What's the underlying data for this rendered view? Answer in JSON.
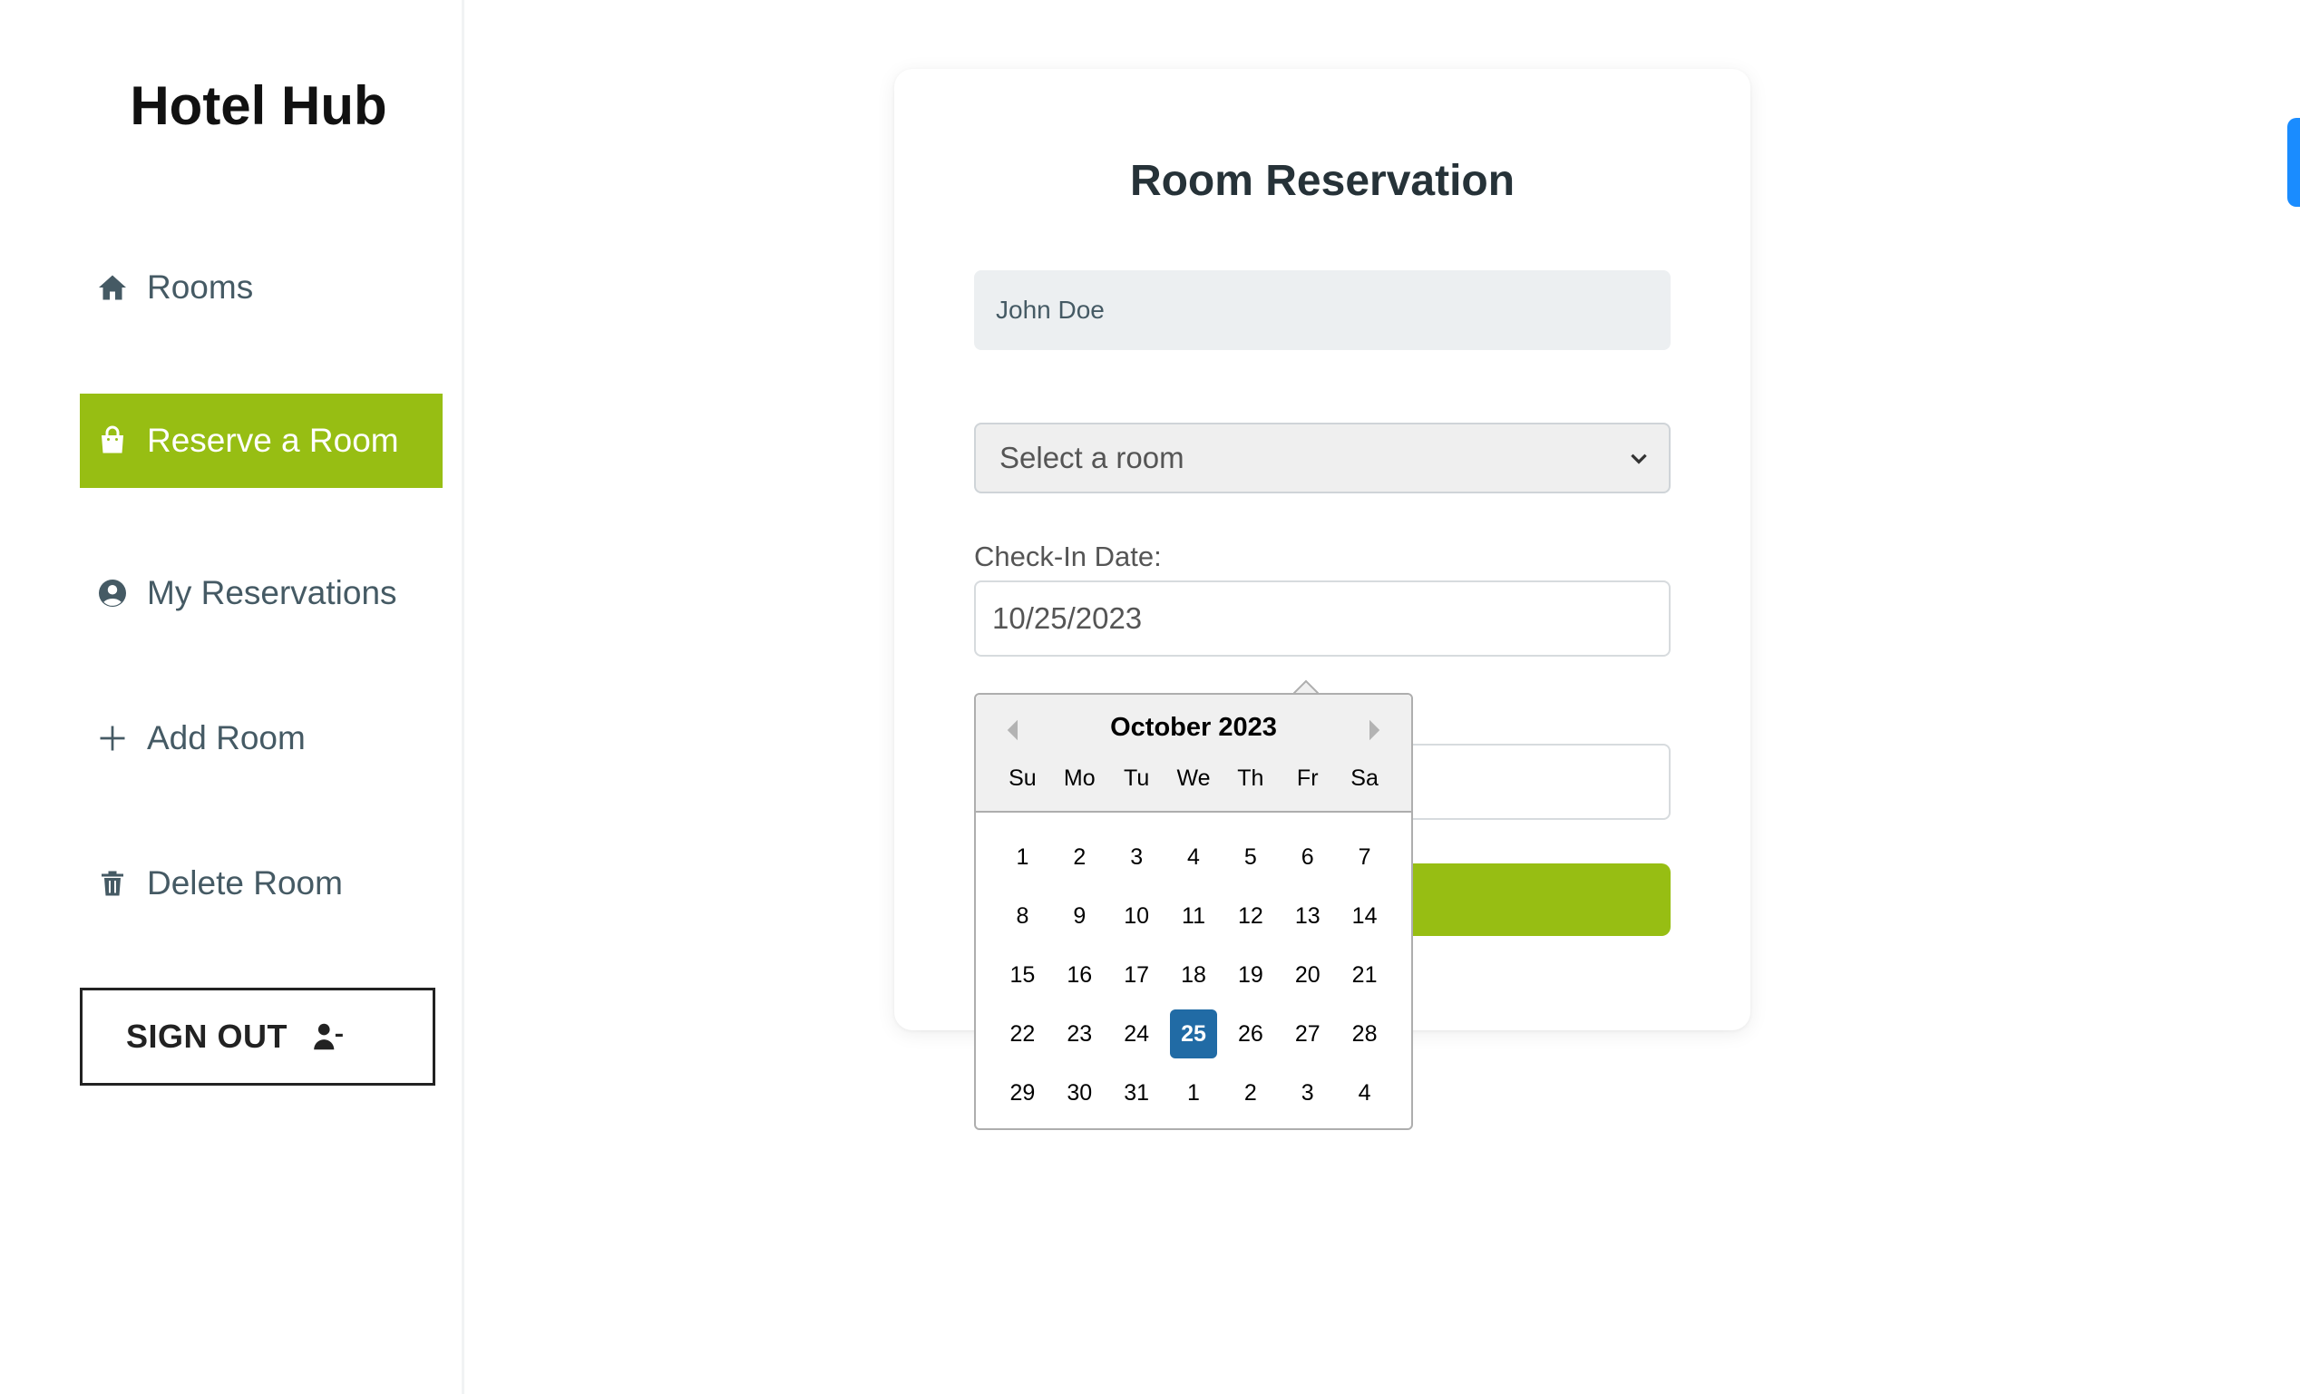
{
  "sidebar": {
    "brand": "Hotel Hub",
    "items": [
      {
        "label": "Rooms",
        "icon": "home-icon"
      },
      {
        "label": "Reserve a Room",
        "icon": "shopping-bag-icon",
        "active": true
      },
      {
        "label": "My Reservations",
        "icon": "user-circle-icon"
      },
      {
        "label": "Add Room",
        "icon": "plus-icon"
      },
      {
        "label": "Delete Room",
        "icon": "trash-icon"
      }
    ],
    "signout": {
      "label": "SIGN OUT",
      "icon": "user-minus-icon"
    }
  },
  "form": {
    "title": "Room Reservation",
    "name_value": "John Doe",
    "room_select": {
      "selected": "Select a room"
    },
    "checkin_label": "Check-In Date:",
    "checkin_value": "10/25/2023",
    "checkout_value": "",
    "submit_label": ""
  },
  "datepicker": {
    "month_label": "October 2023",
    "weekdays": [
      "Su",
      "Mo",
      "Tu",
      "We",
      "Th",
      "Fr",
      "Sa"
    ],
    "weeks": [
      [
        "1",
        "2",
        "3",
        "4",
        "5",
        "6",
        "7"
      ],
      [
        "8",
        "9",
        "10",
        "11",
        "12",
        "13",
        "14"
      ],
      [
        "15",
        "16",
        "17",
        "18",
        "19",
        "20",
        "21"
      ],
      [
        "22",
        "23",
        "24",
        "25",
        "26",
        "27",
        "28"
      ],
      [
        "29",
        "30",
        "31",
        "1",
        "2",
        "3",
        "4"
      ]
    ],
    "selected_day": "25"
  },
  "colors": {
    "accent": "#97be13",
    "selected_day": "#216ba5",
    "edge_tab": "#1a8cff"
  }
}
